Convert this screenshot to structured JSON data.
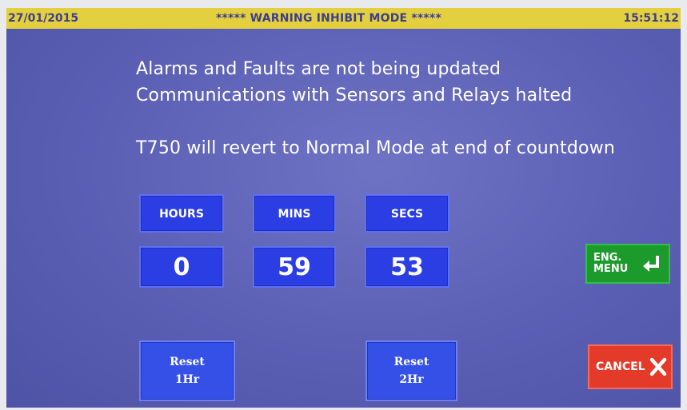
{
  "status_bar": {
    "date": "27/01/2015",
    "title": "***** WARNING INHIBIT MODE *****",
    "time": "15:51:12"
  },
  "messages": {
    "line1": "Alarms and Faults are not being updated",
    "line2": "Communications with Sensors and Relays halted",
    "line3": "T750 will revert to Normal Mode at end of countdown"
  },
  "countdown": {
    "hours_label": "HOURS",
    "mins_label": "MINS",
    "secs_label": "SECS",
    "hours": "0",
    "mins": "59",
    "secs": "53"
  },
  "buttons": {
    "reset_1hr_line1": "Reset",
    "reset_1hr_line2": "1Hr",
    "reset_2hr_line1": "Reset",
    "reset_2hr_line2": "2Hr",
    "eng_menu_line1": "ENG.",
    "eng_menu_line2": "MENU",
    "cancel": "CANCEL"
  },
  "colors": {
    "status_bar": "#e4cf3e",
    "background": "#5b5fb4",
    "tile": "#2b3ee4",
    "eng_menu": "#1d9a2c",
    "cancel": "#e33a2a"
  },
  "icons": {
    "eng_menu": "enter-return-icon",
    "cancel": "close-x-icon"
  }
}
